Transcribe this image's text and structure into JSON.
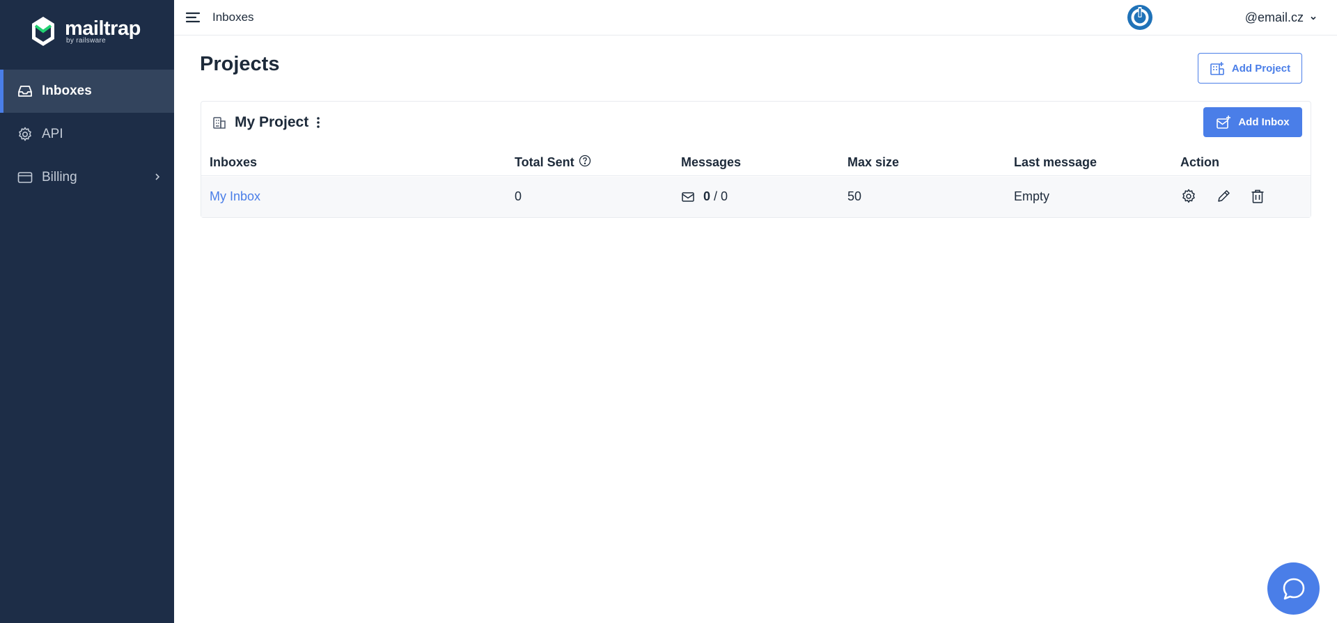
{
  "app": {
    "logo_word": "mailtrap",
    "logo_sub": "by railsware",
    "accent_color": "#4a7ee8",
    "sidebar_color": "#1d2d47"
  },
  "sidebar": {
    "items": [
      {
        "label": "Inboxes",
        "icon": "inbox-icon",
        "active": true
      },
      {
        "label": "API",
        "icon": "gear-icon",
        "active": false
      },
      {
        "label": "Billing",
        "icon": "credit-card-icon",
        "active": false,
        "has_submenu": true
      }
    ]
  },
  "header": {
    "breadcrumb": "Inboxes",
    "account": "@email.cz"
  },
  "main": {
    "title": "Projects",
    "add_project_label": "Add Project",
    "project": {
      "name": "My Project",
      "add_inbox_label": "Add Inbox",
      "columns": [
        "Inboxes",
        "Total Sent",
        "Messages",
        "Max size",
        "Last message",
        "Action"
      ],
      "rows": [
        {
          "inbox": "My Inbox",
          "total_sent": "0",
          "messages_unread": "0",
          "messages_sep": " / ",
          "messages_total": "0",
          "max_size": "50",
          "last_message": "Empty"
        }
      ]
    }
  }
}
